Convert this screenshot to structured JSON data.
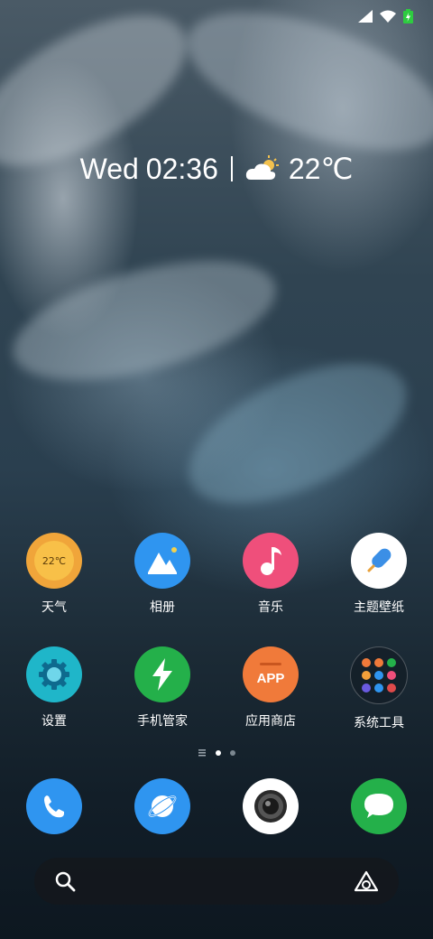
{
  "status_bar": {
    "icons": [
      "cellular-signal-icon",
      "wifi-icon",
      "battery-charging-icon"
    ]
  },
  "widget": {
    "day": "Wed",
    "time": "02:36",
    "weather_icon": "partly-sunny-icon",
    "temperature": "22℃"
  },
  "apps_row1": [
    {
      "name": "weather",
      "label": "天气",
      "badge": "22℃",
      "color": "#F0A53A"
    },
    {
      "name": "gallery",
      "label": "相册",
      "color": "#2F95F0"
    },
    {
      "name": "music",
      "label": "音乐",
      "color": "#EF4F7B"
    },
    {
      "name": "theme",
      "label": "主题壁纸",
      "color": "#FFFFFF"
    }
  ],
  "apps_row2": [
    {
      "name": "settings",
      "label": "设置",
      "color": "#1FB6C9"
    },
    {
      "name": "phone-manager",
      "label": "手机管家",
      "color": "#24B04A"
    },
    {
      "name": "app-store",
      "label": "应用商店",
      "badge": "APP",
      "color": "#F07A3A"
    },
    {
      "name": "system-tools",
      "label": "系统工具",
      "color": "#1B2733"
    }
  ],
  "page_indicator": {
    "pages": 2,
    "current": 1
  },
  "dock": [
    {
      "name": "phone",
      "icon": "phone-icon",
      "color": "#2F95F0"
    },
    {
      "name": "browser",
      "icon": "browser-icon",
      "color": "#2F95F0"
    },
    {
      "name": "camera",
      "icon": "camera-icon",
      "color": "#FFFFFF"
    },
    {
      "name": "messages",
      "icon": "message-icon",
      "color": "#24B04A"
    }
  ],
  "search": {
    "icon": "search-icon",
    "assistant_icon": "assistant-icon"
  }
}
